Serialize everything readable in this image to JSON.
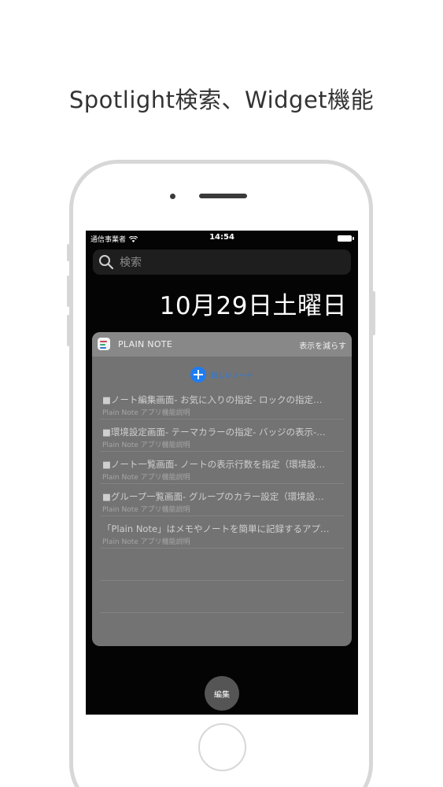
{
  "headline": "Spotlight検索、Widget機能",
  "status_bar": {
    "carrier": "通信事業者",
    "time": "14:54"
  },
  "search": {
    "placeholder": "検索",
    "icon": "search-icon"
  },
  "date": "10月29日土曜日",
  "widget": {
    "app_name": "PLAIN NOTE",
    "toggle_label": "表示を減らす",
    "new_note_label": "新しいノート",
    "notes": [
      {
        "title": "■ノート編集画面- お気に入りの指定- ロックの指定…",
        "subtitle": "Plain Note アプリ機能説明"
      },
      {
        "title": "■環境設定画面- テーマカラーの指定- バッジの表示-…",
        "subtitle": "Plain Note アプリ機能説明"
      },
      {
        "title": "■ノート一覧画面- ノートの表示行数を指定（環境設…",
        "subtitle": "Plain Note アプリ機能説明"
      },
      {
        "title": "■グループ一覧画面- グループのカラー設定（環境設…",
        "subtitle": "Plain Note アプリ機能説明"
      },
      {
        "title": "「Plain Note」はメモやノートを簡単に記録するアプ…",
        "subtitle": "Plain Note アプリ機能説明"
      }
    ]
  },
  "edit_button_label": "編集",
  "colors": {
    "accent": "#1e7cf2",
    "screen_bg": "#040404",
    "widget_bg": "#737373"
  }
}
